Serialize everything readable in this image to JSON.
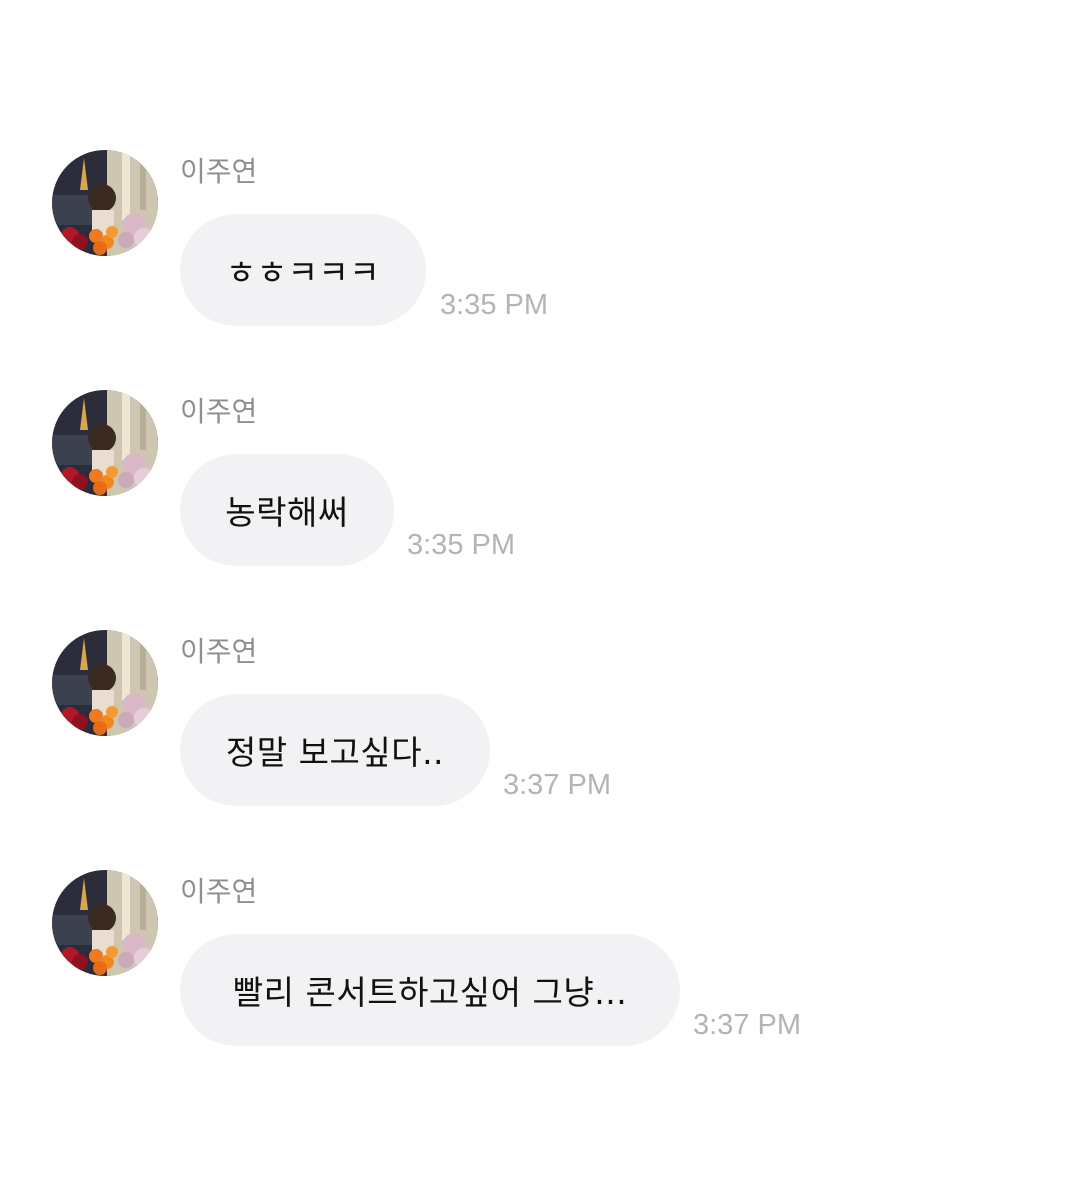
{
  "messages": [
    {
      "sender": "이주연",
      "text": "ㅎㅎㅋㅋㅋ",
      "time": "3:35 PM"
    },
    {
      "sender": "이주연",
      "text": "농락해써",
      "time": "3:35 PM"
    },
    {
      "sender": "이주연",
      "text": "정말 보고싶다..",
      "time": "3:37 PM"
    },
    {
      "sender": "이주연",
      "text": "빨리 콘서트하고싶어 그냥...",
      "time": "3:37 PM"
    }
  ],
  "colors": {
    "bubble_bg": "#f2f2f5",
    "sender_text": "#8e8e93",
    "timestamp_text": "#b4b4b8",
    "message_text": "#111111"
  }
}
